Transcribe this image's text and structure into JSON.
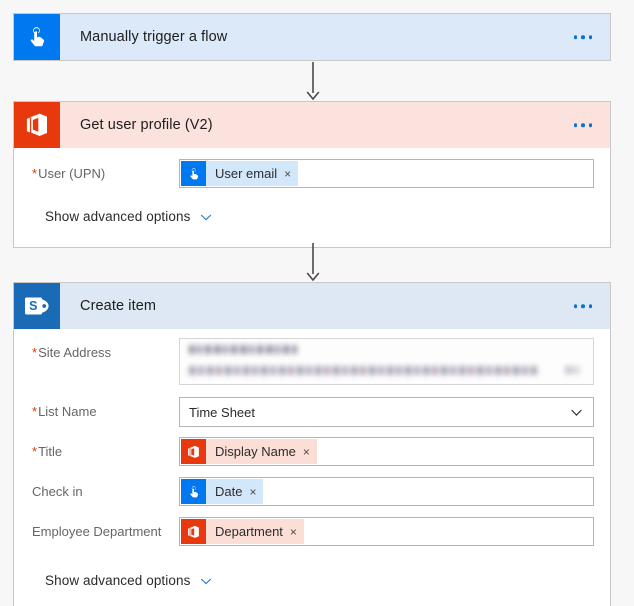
{
  "flow": {
    "steps": [
      {
        "id": "manual-trigger",
        "title": "Manually trigger a flow",
        "icon": "tap-hand-icon",
        "connector_brand": "flow-trigger",
        "header_color": "#dbe9f9",
        "icon_color": "#0078ef",
        "menu_label": "...",
        "fields": []
      },
      {
        "id": "get-user-profile",
        "title": "Get user profile (V2)",
        "icon": "office365-icon",
        "connector_brand": "office-365-users",
        "header_color": "#fbe2dc",
        "icon_color": "#e8380d",
        "menu_label": "...",
        "advanced_label": "Show advanced options",
        "fields": [
          {
            "label": "User (UPN)",
            "required": true,
            "type": "token",
            "token": {
              "text": "User email",
              "icon": "tap-hand-icon",
              "chip_bg": "#d3e7fb",
              "icon_bg": "#0078ef",
              "remove_label": "×"
            }
          }
        ]
      },
      {
        "id": "create-item",
        "title": "Create item",
        "icon": "sharepoint-icon",
        "connector_brand": "sharepoint",
        "header_color": "#dde8f4",
        "icon_color": "#1a6bb5",
        "menu_label": "...",
        "advanced_label": "Show advanced options",
        "fields": [
          {
            "label": "Site Address",
            "required": true,
            "type": "redacted",
            "value": ""
          },
          {
            "label": "List Name",
            "required": true,
            "type": "dropdown",
            "value": "Time Sheet",
            "chevron": "chevron-down-icon"
          },
          {
            "label": "Title",
            "required": true,
            "type": "token",
            "token": {
              "text": "Display Name",
              "icon": "office365-icon",
              "chip_bg": "#fbded5",
              "icon_bg": "#e8380d",
              "remove_label": "×"
            }
          },
          {
            "label": "Check in",
            "required": false,
            "type": "token",
            "token": {
              "text": "Date",
              "icon": "tap-hand-icon",
              "chip_bg": "#d3e7fb",
              "icon_bg": "#0078ef",
              "remove_label": "×"
            }
          },
          {
            "label": "Employee Department",
            "required": false,
            "type": "token",
            "token": {
              "text": "Department",
              "icon": "office365-icon",
              "chip_bg": "#fbded5",
              "icon_bg": "#e8380d",
              "remove_label": "×"
            }
          }
        ]
      }
    ],
    "required_marker": "*",
    "canvas_background": "#f7f7f7",
    "connector_color": "#4a4a4a"
  }
}
